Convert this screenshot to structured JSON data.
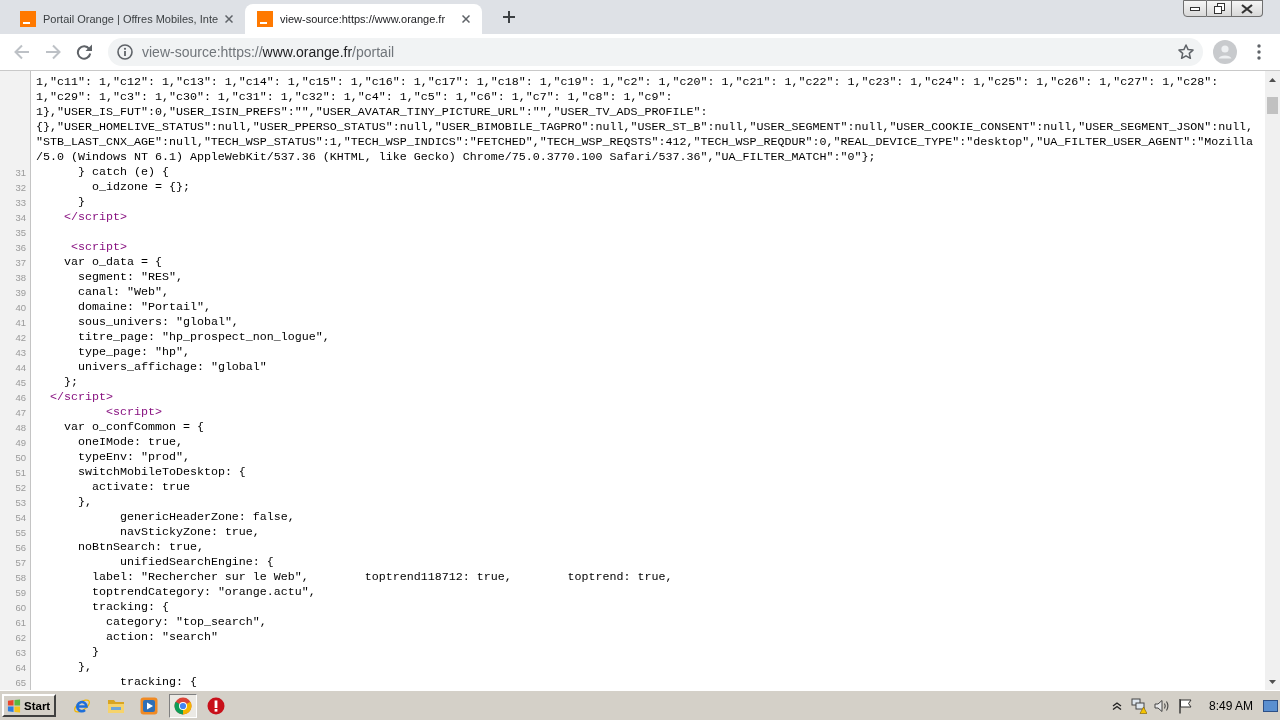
{
  "tabs": [
    {
      "title": "Portail Orange | Offres Mobiles, Inte",
      "selected": false
    },
    {
      "title": "view-source:https://www.orange.fr",
      "selected": true
    }
  ],
  "toolbar": {
    "nav": [
      {
        "kind": "back",
        "disabled": true
      },
      {
        "kind": "forward",
        "disabled": true
      },
      {
        "kind": "reload",
        "disabled": false
      }
    ],
    "address": {
      "scheme": "view-source:https://",
      "host": "www.orange.fr",
      "path": "/portail"
    }
  },
  "source": {
    "wrapped_rows": [
      "1,\"c11\": 1,\"c12\": 1,\"c13\": 1,\"c14\": 1,\"c15\": 1,\"c16\": 1,\"c17\": 1,\"c18\": 1,\"c19\": 1,\"c2\": 1,\"c20\": 1,\"c21\": 1,\"c22\": 1,\"c23\": 1,\"c24\": 1,\"c25\": 1,\"c26\": 1,\"c27\": 1,\"c28\":",
      "1,\"c29\": 1,\"c3\": 1,\"c30\": 1,\"c31\": 1,\"c32\": 1,\"c4\": 1,\"c5\": 1,\"c6\": 1,\"c7\": 1,\"c8\": 1,\"c9\":",
      "1},\"USER_IS_FUT\":0,\"USER_ISIN_PREFS\":\"\",\"USER_AVATAR_TINY_PICTURE_URL\":\"\",\"USER_TV_ADS_PROFILE\":",
      "{},\"USER_HOMELIVE_STATUS\":null,\"USER_PPERSO_STATUS\":null,\"USER_BIMOBILE_TAGPRO\":null,\"USER_ST_B\":null,\"USER_SEGMENT\":null,\"USER_COOKIE_CONSENT\":null,\"USER_SEGMENT_JSON\":null,",
      "\"STB_LAST_CNX_AGE\":null,\"TECH_WSP_STATUS\":1,\"TECH_WSP_INDICS\":\"FETCHED\",\"TECH_WSP_REQSTS\":412,\"TECH_WSP_REQDUR\":0,\"REAL_DEVICE_TYPE\":\"desktop\",\"UA_FILTER_USER_AGENT\":\"Mozilla",
      "/5.0 (Windows NT 6.1) AppleWebKit/537.36 (KHTML, like Gecko) Chrome/75.0.3770.100 Safari/537.36\",\"UA_FILTER_MATCH\":\"0\"};"
    ],
    "lines": [
      {
        "number": "31",
        "kind": "code",
        "text": "      } catch (e) {"
      },
      {
        "number": "32",
        "kind": "code",
        "text": "        o_idzone = {};"
      },
      {
        "number": "33",
        "kind": "code",
        "text": "      }"
      },
      {
        "number": "34",
        "kind": "tag",
        "text": "    </script>"
      },
      {
        "number": "35",
        "kind": "code"
      },
      {
        "number": "36",
        "kind": "tag",
        "text": "     <script>"
      },
      {
        "number": "37",
        "kind": "code",
        "text": "    var o_data = {"
      },
      {
        "number": "38",
        "kind": "code",
        "text": "      segment: \"RES\","
      },
      {
        "number": "39",
        "kind": "code",
        "text": "      canal: \"Web\","
      },
      {
        "number": "40",
        "kind": "code",
        "text": "      domaine: \"Portail\","
      },
      {
        "number": "41",
        "kind": "code",
        "text": "      sous_univers: \"global\","
      },
      {
        "number": "42",
        "kind": "code",
        "text": "      titre_page: \"hp_prospect_non_logue\","
      },
      {
        "number": "43",
        "kind": "code",
        "text": "      type_page: \"hp\","
      },
      {
        "number": "44",
        "kind": "code",
        "text": "      univers_affichage: \"global\""
      },
      {
        "number": "45",
        "kind": "code",
        "text": "    };"
      },
      {
        "number": "46",
        "kind": "tag",
        "text": "  </script>"
      },
      {
        "number": "47",
        "kind": "tag",
        "text": "          <script>"
      },
      {
        "number": "48",
        "kind": "code",
        "text": "    var o_confCommon = {"
      },
      {
        "number": "49",
        "kind": "code",
        "text": "      oneIMode: true,"
      },
      {
        "number": "50",
        "kind": "code",
        "text": "      typeEnv: \"prod\","
      },
      {
        "number": "51",
        "kind": "code",
        "text": "      switchMobileToDesktop: {"
      },
      {
        "number": "52",
        "kind": "code",
        "text": "        activate: true"
      },
      {
        "number": "53",
        "kind": "code",
        "text": "      },"
      },
      {
        "number": "54",
        "kind": "code",
        "text": "            genericHeaderZone: false,"
      },
      {
        "number": "55",
        "kind": "code",
        "text": "            navStickyZone: true,"
      },
      {
        "number": "56",
        "kind": "code",
        "text": "      noBtnSearch: true,"
      },
      {
        "number": "57",
        "kind": "code",
        "text": "            unifiedSearchEngine: {"
      },
      {
        "number": "58",
        "kind": "code",
        "text": "        label: \"Rechercher sur le Web\",        toptrend118712: true,        toptrend: true,"
      },
      {
        "number": "59",
        "kind": "code",
        "text": "        toptrendCategory: \"orange.actu\","
      },
      {
        "number": "60",
        "kind": "code",
        "text": "        tracking: {"
      },
      {
        "number": "61",
        "kind": "code",
        "text": "          category: \"top_search\","
      },
      {
        "number": "62",
        "kind": "code",
        "text": "          action: \"search\""
      },
      {
        "number": "63",
        "kind": "code",
        "text": "        }"
      },
      {
        "number": "64",
        "kind": "code",
        "text": "      },"
      },
      {
        "number": "65",
        "kind": "code",
        "text": "            tracking: {"
      }
    ]
  },
  "taskbar": {
    "start": "Start",
    "apps": [
      {
        "kind": "ie",
        "selected": false
      },
      {
        "kind": "explorer",
        "selected": false
      },
      {
        "kind": "player",
        "selected": false
      },
      {
        "kind": "chrome",
        "selected": true
      },
      {
        "kind": "stop",
        "selected": false
      }
    ],
    "clock": "8:49 AM"
  }
}
